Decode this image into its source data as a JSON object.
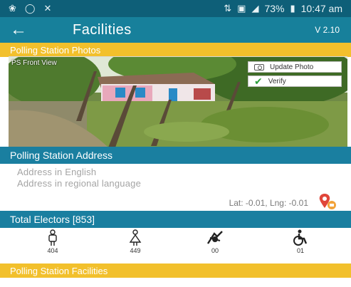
{
  "status_bar": {
    "left_icons": [
      "photos-icon",
      "chat-icon",
      "missed-call-icon"
    ],
    "right_icons": [
      "data-indicator-icon",
      "sim-icon",
      "signal-icon"
    ],
    "battery": "73%",
    "time": "10:47 am"
  },
  "app_bar": {
    "back_icon": "arrow-back-icon",
    "title": "Facilities",
    "version": "V 2.10"
  },
  "photos_section": {
    "header": "Polling Station Photos",
    "photo_label": "PS Front View",
    "update_button": "Update Photo",
    "verify_button": "Verify"
  },
  "address_section": {
    "header": "Polling Station Address",
    "address_english": "Address in English",
    "address_regional": "Address in regional language",
    "coords": "Lat: -0.01, Lng: -0.01",
    "location_icon": "location-pin-icon"
  },
  "electors_section": {
    "header": "Total Electors [853]",
    "items": [
      {
        "icon": "male-icon",
        "count": "404"
      },
      {
        "icon": "female-icon",
        "count": "449"
      },
      {
        "icon": "third-gender-icon",
        "count": "00"
      },
      {
        "icon": "wheelchair-icon",
        "count": "01"
      }
    ]
  },
  "facilities_section": {
    "header": "Polling Station Facilities"
  },
  "colors": {
    "status_bar": "#0e5f78",
    "app_bar": "#17809b",
    "section_blue": "#1a7fa0",
    "section_yellow": "#f2c02c"
  }
}
